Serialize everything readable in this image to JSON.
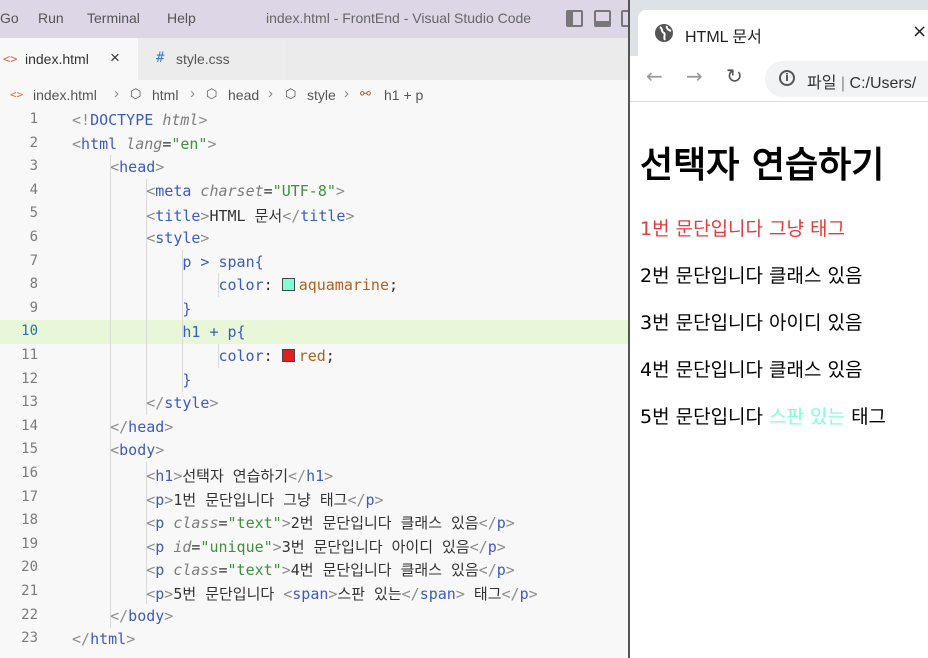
{
  "vscode": {
    "menu": [
      "Go",
      "Run",
      "Terminal",
      "Help"
    ],
    "window_title": "index.html - FrontEnd - Visual Studio Code",
    "tabs": [
      {
        "label": "index.html",
        "icon": "html-file-icon",
        "active": true,
        "close": "×"
      },
      {
        "label": "style.css",
        "icon": "hash-icon",
        "glyph": "#"
      }
    ],
    "breadcrumb": [
      "index.html",
      "html",
      "head",
      "style",
      "h1 + p"
    ],
    "active_line": 10,
    "swatch_colors": {
      "aquamarine": "#7fffd4",
      "red": "#e02020"
    },
    "lines": [
      {
        "n": "1",
        "code": "<!DOCTYPE html>"
      },
      {
        "n": "2",
        "code": "<html lang=\"en\">"
      },
      {
        "n": "3",
        "code": "<head>"
      },
      {
        "n": "4",
        "code": "<meta charset=\"UTF-8\">"
      },
      {
        "n": "5",
        "code": "<title>HTML 문서</title>"
      },
      {
        "n": "6",
        "code": "<style>"
      },
      {
        "n": "7",
        "code": "p > span{"
      },
      {
        "n": "8",
        "code": "color: aquamarine;"
      },
      {
        "n": "9",
        "code": "}"
      },
      {
        "n": "10",
        "code": "h1 + p{"
      },
      {
        "n": "11",
        "code": "color: red;"
      },
      {
        "n": "12",
        "code": "}"
      },
      {
        "n": "13",
        "code": "</style>"
      },
      {
        "n": "14",
        "code": "</head>"
      },
      {
        "n": "15",
        "code": "<body>"
      },
      {
        "n": "16",
        "code": "<h1>선택자 연습하기</h1>"
      },
      {
        "n": "17",
        "code": "<p>1번 문단입니다 그냥 태그</p>"
      },
      {
        "n": "18",
        "code": "<p class=\"text\">2번 문단입니다 클래스 있음</p>"
      },
      {
        "n": "19",
        "code": "<p id=\"unique\">3번 문단입니다 아이디 있음</p>"
      },
      {
        "n": "20",
        "code": "<p class=\"text\">4번 문단입니다 클래스 있음</p>"
      },
      {
        "n": "21",
        "code": "<p>5번 문단입니다 <span>스판 있는</span> 태그</p>"
      },
      {
        "n": "22",
        "code": "</body>"
      },
      {
        "n": "23",
        "code": "</html>"
      }
    ]
  },
  "browser": {
    "tab_title": "HTML 문서",
    "tab_close": "×",
    "back": "←",
    "forward": "→",
    "reload": "↻",
    "info": "i",
    "omnibox_label": "파일",
    "omnibox_sep": "|",
    "omnibox_url": "C:/Users/",
    "page": {
      "h1": "선택자 연습하기",
      "p1": "1번 문단입니다 그냥 태그",
      "p2": "2번 문단입니다 클래스 있음",
      "p3": "3번 문단입니다 아이디 있음",
      "p4": "4번 문단입니다 클래스 있음",
      "p5_before": "5번 문단입니다 ",
      "p5_span": "스판 있는",
      "p5_after": " 태그"
    },
    "colors": {
      "p1": "#e13b3b",
      "span": "#7fffd4"
    }
  }
}
